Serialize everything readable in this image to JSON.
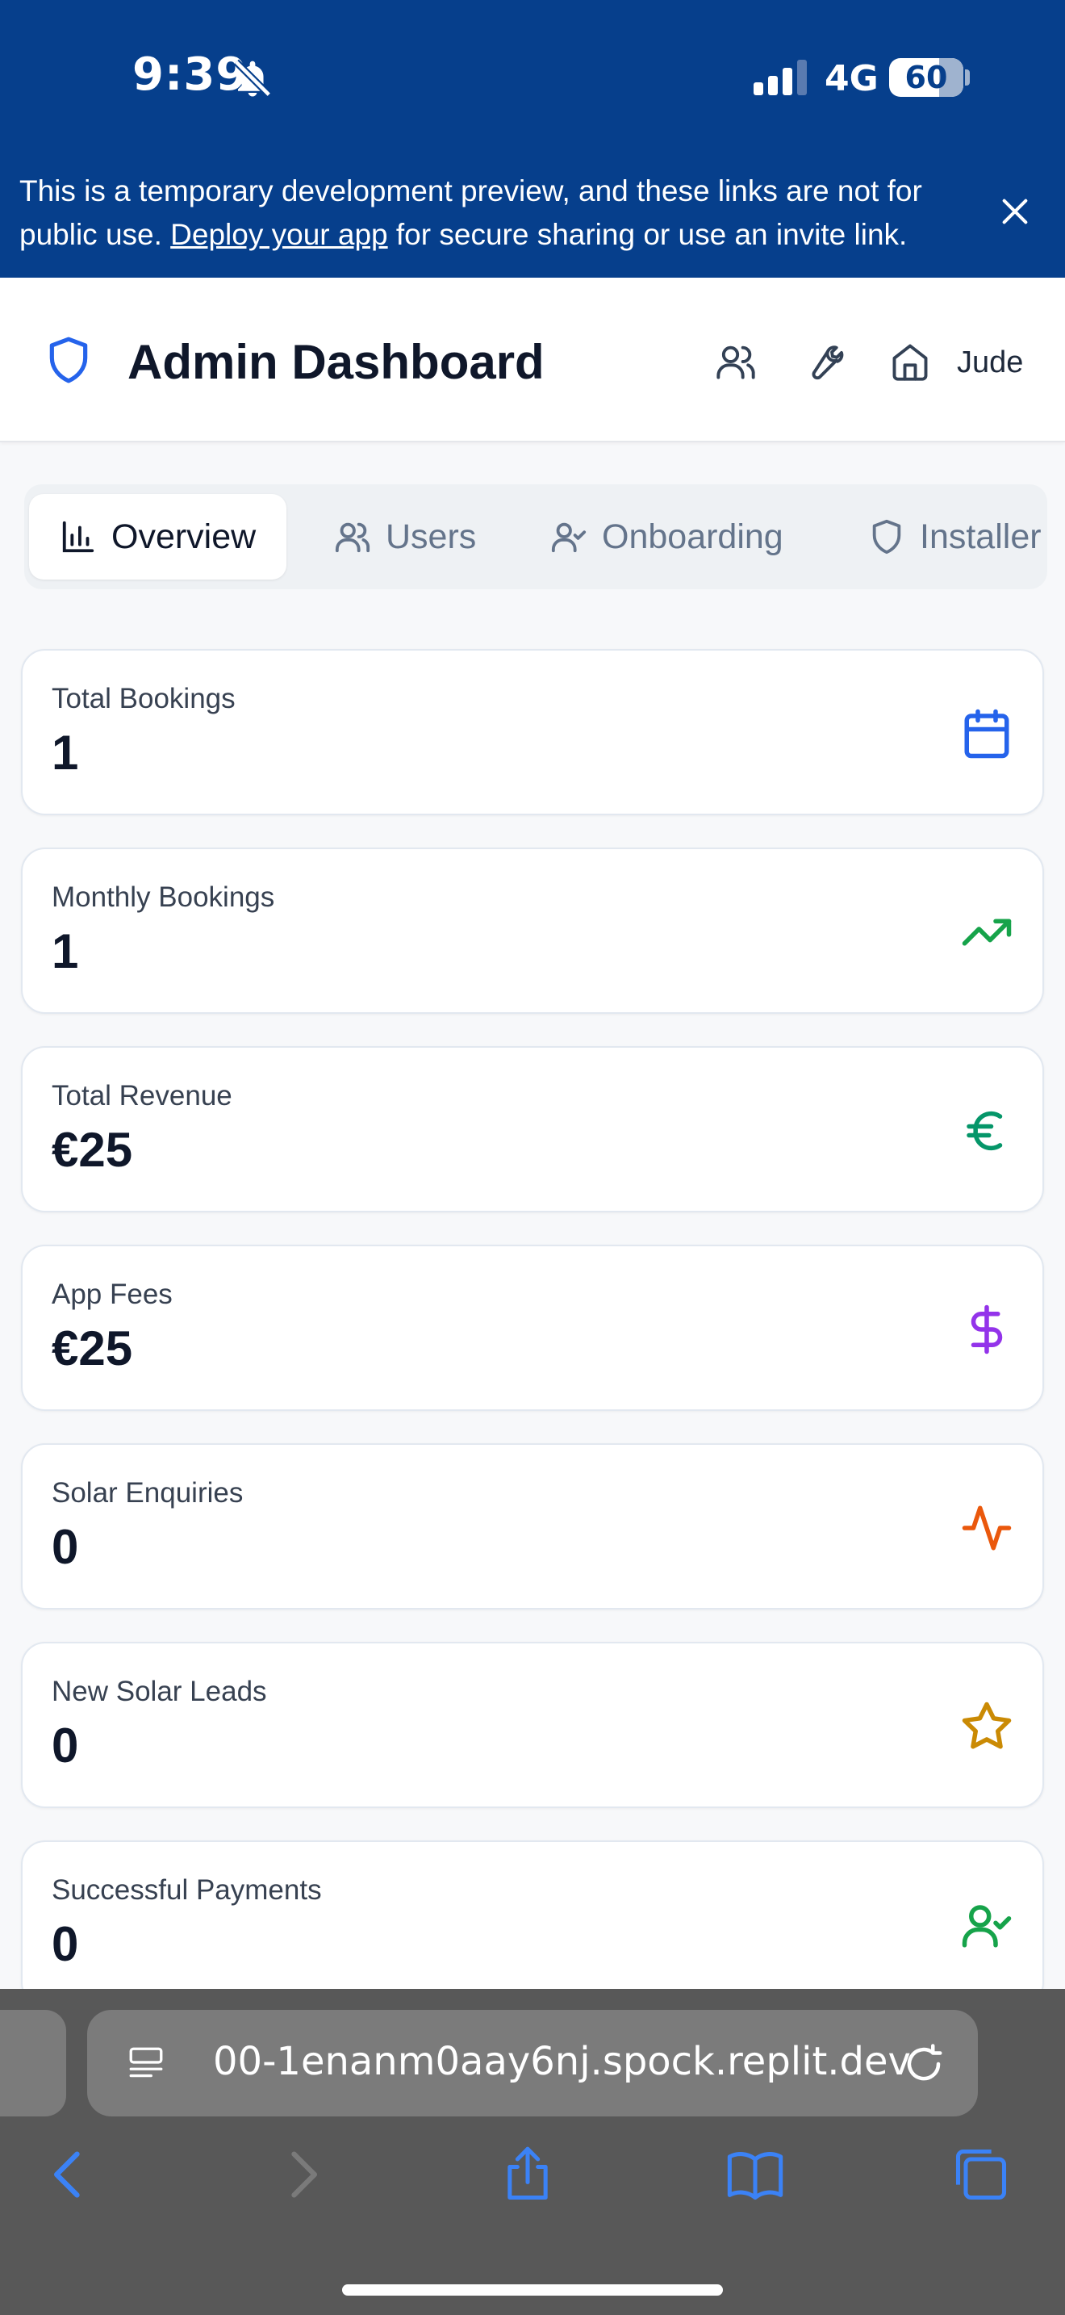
{
  "status_bar": {
    "time": "9:39",
    "network": "4G",
    "battery": "60"
  },
  "banner": {
    "text_before": "This is a temporary development preview, and these links are not for public use. ",
    "link": "Deploy your app",
    "text_after": " for secure sharing or use an invite link."
  },
  "header": {
    "title": "Admin Dashboard",
    "user": "Jude"
  },
  "tabs": [
    {
      "label": "Overview",
      "icon": "bar-chart-icon"
    },
    {
      "label": "Users",
      "icon": "users-icon"
    },
    {
      "label": "Onboarding",
      "icon": "user-check-icon"
    },
    {
      "label": "Installer",
      "icon": "shield-icon"
    }
  ],
  "cards": [
    {
      "label": "Total Bookings",
      "value": "1",
      "icon": "calendar-icon",
      "color": "#2563eb"
    },
    {
      "label": "Monthly Bookings",
      "value": "1",
      "icon": "trending-up-icon",
      "color": "#16a34a"
    },
    {
      "label": "Total Revenue",
      "value": "€25",
      "icon": "euro-icon",
      "color": "#059669"
    },
    {
      "label": "App Fees",
      "value": "€25",
      "icon": "dollar-icon",
      "color": "#9333ea"
    },
    {
      "label": "Solar Enquiries",
      "value": "0",
      "icon": "activity-icon",
      "color": "#ea580c"
    },
    {
      "label": "New Solar Leads",
      "value": "0",
      "icon": "star-icon",
      "color": "#ca8a04"
    },
    {
      "label": "Successful Payments",
      "value": "0",
      "icon": "user-check-icon",
      "color": "#16a34a"
    }
  ],
  "browser": {
    "url": "00-1enanm0aay6nj.spock.replit.dev"
  }
}
